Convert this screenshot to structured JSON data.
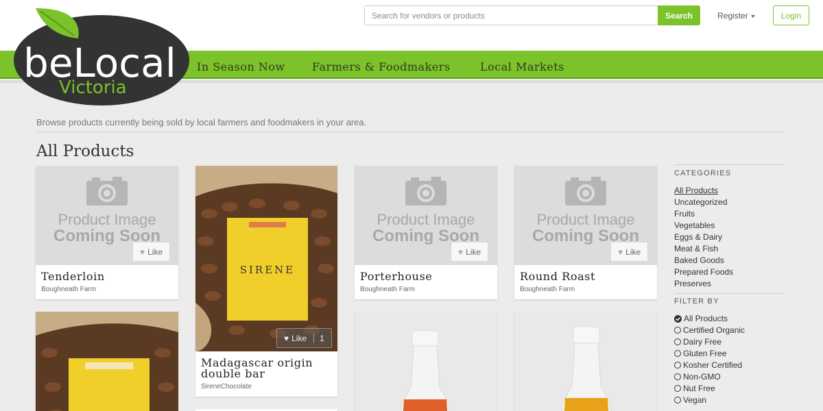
{
  "brand": {
    "logo_main": "beLocal",
    "logo_sub": "Victoria"
  },
  "header": {
    "search_placeholder": "Search for vendors or products",
    "search_button": "Search",
    "register_label": "Register",
    "login_label": "Login"
  },
  "nav": {
    "items": [
      "In Season Now",
      "Farmers & Foodmakers",
      "Local Markets"
    ]
  },
  "content": {
    "intro": "Browse products currently being sold by local farmers and foodmakers in your area.",
    "title": "All Products",
    "placeholder_line1": "Product Image",
    "placeholder_line2": "Coming Soon",
    "like_label": "Like",
    "products": [
      {
        "name": "Tenderloin",
        "vendor": "Boughneath Farm"
      },
      {
        "name": "Madagascar origin double bar",
        "name_line1": "Madagascar origin",
        "name_line2": "double bar",
        "vendor": "SireneChocolate",
        "likes": "1",
        "package_text": "SIRENE"
      },
      {
        "name": "Porterhouse",
        "vendor": "Boughneath Farm"
      },
      {
        "name": "Round Roast",
        "vendor": "Boughneath Farm"
      }
    ]
  },
  "sidebar": {
    "categories_heading": "CATEGORIES",
    "categories": [
      "All Products",
      "Uncategorized",
      "Fruits",
      "Vegetables",
      "Eggs & Dairy",
      "Meat & Fish",
      "Baked Goods",
      "Prepared Foods",
      "Preserves"
    ],
    "active_category": "All Products",
    "filter_heading": "FILTER BY",
    "filters": [
      "All Products",
      "Certified Organic",
      "Dairy Free",
      "Gluten Free",
      "Kosher Certified",
      "Non-GMO",
      "Nut Free",
      "Vegan"
    ],
    "active_filter": "All Products"
  },
  "colors": {
    "accent": "#7cc22a",
    "logo_dark": "#333333",
    "nav_text": "#2f3a1c"
  },
  "icons": [
    "camera-icon",
    "heart-icon",
    "check-circle-icon",
    "radio-icon",
    "caret-down-icon",
    "leaf-icon"
  ]
}
